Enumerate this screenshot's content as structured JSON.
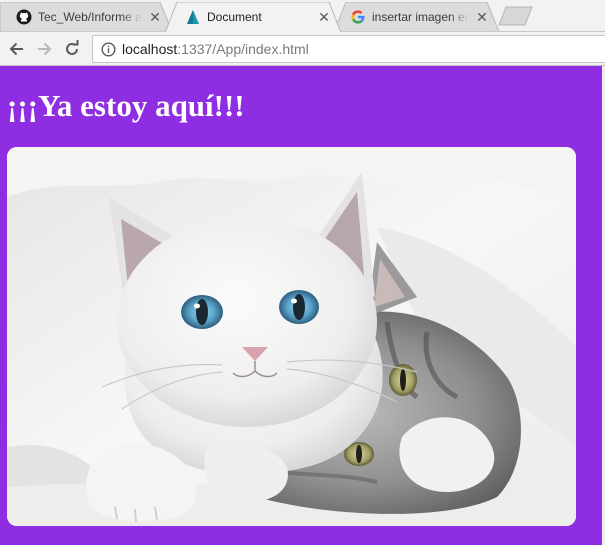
{
  "browser": {
    "tabs": [
      {
        "title": "Tec_Web/Informe a",
        "icon": "github-icon",
        "active": false
      },
      {
        "title": "Document",
        "icon": "document-favicon-icon",
        "active": true
      },
      {
        "title": "insertar imagen en",
        "icon": "google-icon",
        "active": false
      }
    ],
    "close_glyph": "✕",
    "url_host": "localhost",
    "url_rest": ":1337/App/index.html"
  },
  "page": {
    "heading": "¡¡¡Ya estoy aquí!!!",
    "background_color": "#8e2de2",
    "image_subject": "white kitten lying on a grey tabby kitten under a white blanket"
  }
}
